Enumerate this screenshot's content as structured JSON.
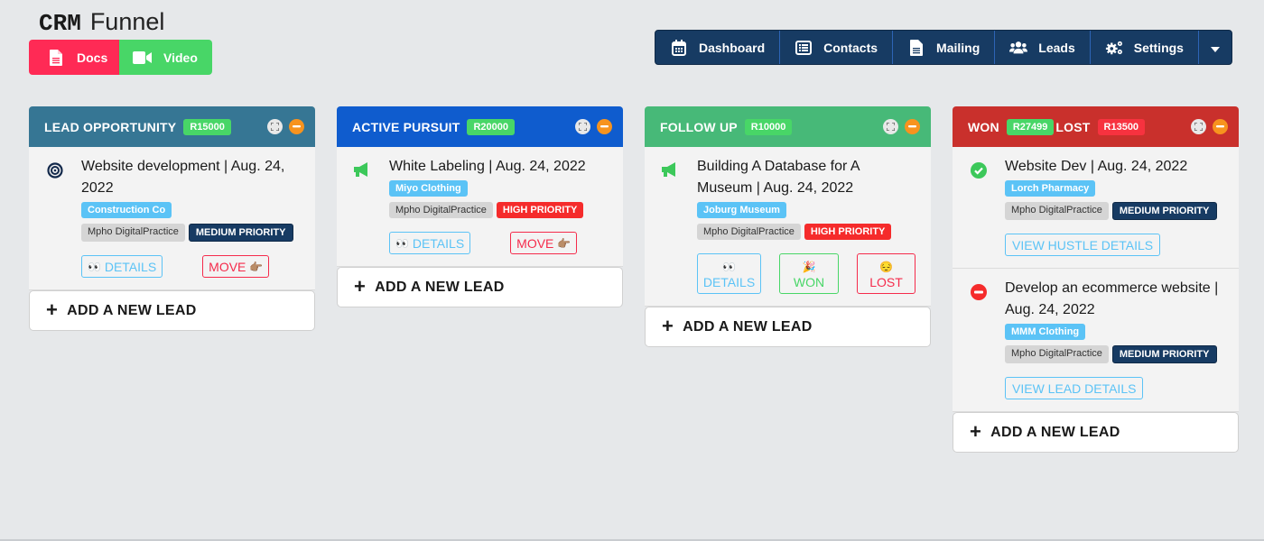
{
  "app": {
    "title_bold": "CRM",
    "title_rest": "Funnel"
  },
  "quick_links": [
    {
      "label": "Docs",
      "icon": "file-icon",
      "color": "#ff2a55"
    },
    {
      "label": "Video",
      "icon": "video-camera-icon",
      "color": "#48d667"
    }
  ],
  "nav": {
    "items": [
      {
        "label": "Dashboard",
        "icon": "calendar-icon"
      },
      {
        "label": "Contacts",
        "icon": "address-list-icon"
      },
      {
        "label": "Mailing",
        "icon": "document-icon"
      },
      {
        "label": "Leads",
        "icon": "users-icon"
      },
      {
        "label": "Settings",
        "icon": "gears-icon"
      }
    ],
    "dropdown_icon": "caret-down-icon",
    "background": "#173b63"
  },
  "columns": [
    {
      "title": "LEAD OPPORTUNITY",
      "amount": "R15000",
      "color": "#367694",
      "cards": [
        {
          "icon": "bullseye-icon",
          "title": "Website development | Aug. 24, 2022",
          "client": "Construction Co",
          "owner": "Mpho DigitalPractice",
          "priority": "MEDIUM PRIORITY",
          "details_label": "DETAILS",
          "move_label": "MOVE"
        }
      ],
      "add_label": "ADD A NEW LEAD"
    },
    {
      "title": "ACTIVE PURSUIT",
      "amount": "R20000",
      "color": "#0f5cce",
      "cards": [
        {
          "icon": "megaphone-icon",
          "title": "White Labeling | Aug. 24, 2022",
          "client": "Miyo Clothing",
          "owner": "Mpho DigitalPractice",
          "priority": "HIGH PRIORITY",
          "details_label": "DETAILS",
          "move_label": "MOVE"
        }
      ],
      "add_label": "ADD A NEW LEAD"
    },
    {
      "title": "FOLLOW UP",
      "amount": "R10000",
      "color": "#47b978",
      "cards": [
        {
          "icon": "megaphone-icon",
          "title": "Building A Database for A Museum | Aug. 24, 2022",
          "client": "Joburg Museum",
          "owner": "Mpho DigitalPractice",
          "priority": "HIGH PRIORITY",
          "details_label": "DETAILS",
          "won_label": "WON",
          "lost_label": "LOST"
        }
      ],
      "add_label": "ADD A NEW LEAD"
    },
    {
      "title_won": "WON",
      "amount_won": "R27499",
      "title_lost": "LOST",
      "amount_lost": "R13500",
      "color": "#c9302c",
      "cards": [
        {
          "icon": "check-circle-icon",
          "title": "Website Dev | Aug. 24, 2022",
          "client": "Lorch Pharmacy",
          "owner": "Mpho DigitalPractice",
          "priority": "MEDIUM PRIORITY",
          "view_label": "VIEW HUSTLE DETAILS"
        },
        {
          "icon": "minus-circle-icon",
          "title": "Develop an ecommerce website | Aug. 24, 2022",
          "client": "MMM Clothing",
          "owner": "Mpho DigitalPractice",
          "priority": "MEDIUM PRIORITY",
          "view_label": "VIEW LEAD DETAILS"
        }
      ],
      "add_label": "ADD A NEW LEAD"
    }
  ],
  "emojis": {
    "eyes": "👀",
    "point_right": "👉🏽",
    "party": "🎉",
    "sad": "😔"
  }
}
